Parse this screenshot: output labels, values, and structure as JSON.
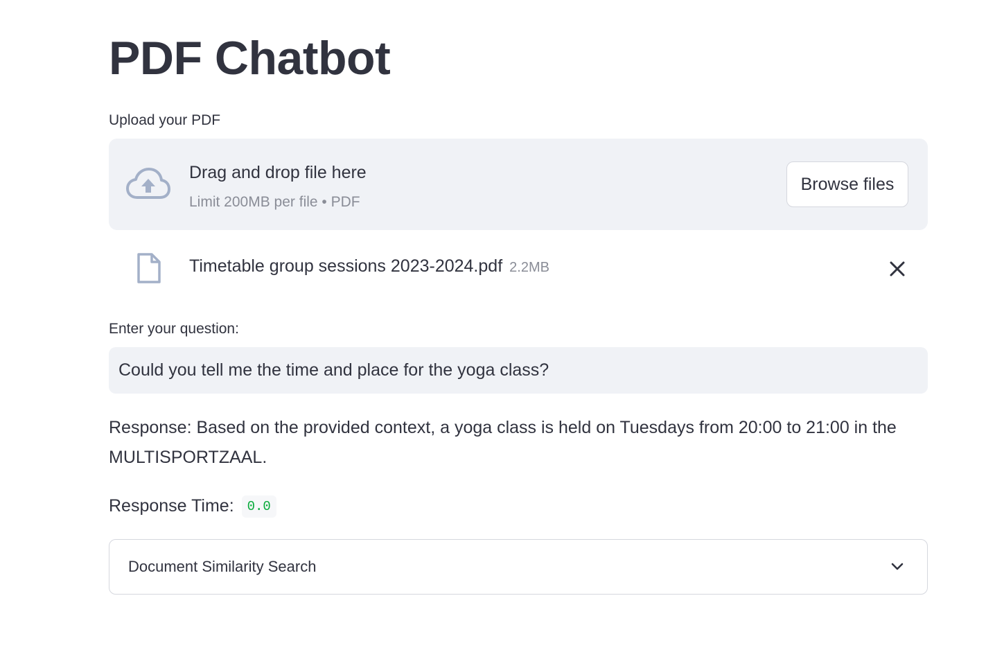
{
  "page": {
    "title": "PDF Chatbot"
  },
  "uploader": {
    "label": "Upload your PDF",
    "drop_title": "Drag and drop file here",
    "drop_subtitle": "Limit 200MB per file • PDF",
    "browse_label": "Browse files",
    "icon": "cloud-upload-icon"
  },
  "uploaded_file": {
    "name": "Timetable group sessions 2023-2024.pdf",
    "size": "2.2MB",
    "icon": "file-icon",
    "remove_icon": "close-icon"
  },
  "question": {
    "label": "Enter your question:",
    "value": "Could you tell me the time and place for the yoga class?"
  },
  "response": {
    "text": "Response: Based on the provided context, a yoga class is held on Tuesdays from 20:00 to 21:00 in the MULTISPORTZAAL."
  },
  "response_time": {
    "label": "Response Time:",
    "value": "0.0"
  },
  "expander": {
    "label": "Document Similarity Search",
    "icon": "chevron-down-icon"
  },
  "colors": {
    "text": "#31333f",
    "muted": "#8a8d97",
    "panel": "#f0f2f6",
    "code_green": "#09ab3b",
    "icon_blue_gray": "#a3b0c8",
    "border": "#d5d7de"
  }
}
